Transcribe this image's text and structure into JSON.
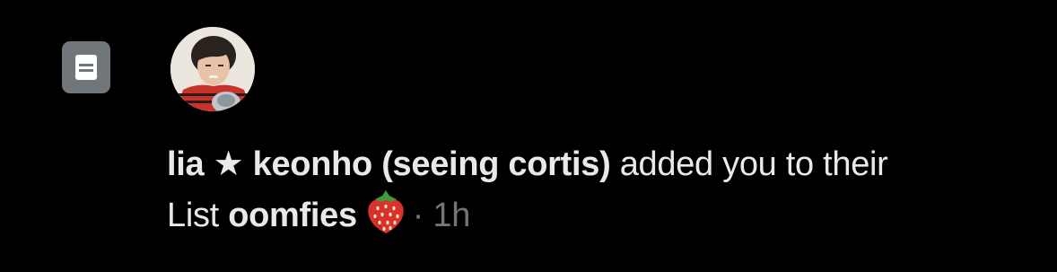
{
  "notification": {
    "type_icon": "list-icon",
    "avatar": "user-avatar",
    "actor_name": "lia ★ keonho (seeing cortis)",
    "action_text": " added you to their",
    "list_prefix": "List ",
    "list_name": "oomfies",
    "list_emoji": "strawberry-emoji",
    "separator": "·",
    "time": "1h"
  },
  "colors": {
    "background": "#000000",
    "text": "#e7e9ea",
    "muted": "#71767b"
  }
}
